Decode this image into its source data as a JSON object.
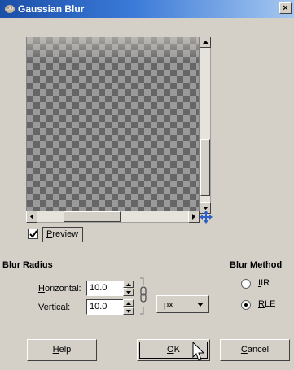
{
  "window": {
    "title": "Gaussian Blur",
    "close_label": "×"
  },
  "preview": {
    "checkbox_label": "Preview",
    "checked": true,
    "accel": "P"
  },
  "blur_radius": {
    "title": "Blur Radius",
    "horizontal": {
      "label": "Horizontal:",
      "accel": "H",
      "value": "10.0"
    },
    "vertical": {
      "label": "Vertical:",
      "accel": "V",
      "value": "10.0"
    },
    "unit": "px"
  },
  "blur_method": {
    "title": "Blur Method",
    "options": [
      {
        "label": "IIR",
        "accel": "I",
        "selected": false
      },
      {
        "label": "RLE",
        "accel": "R",
        "selected": true
      }
    ]
  },
  "buttons": {
    "help": "Help",
    "ok": "OK",
    "cancel": "Cancel"
  },
  "colors": {
    "titlebar_start": "#1b4fa8",
    "titlebar_end": "#a6c8f0",
    "dialog_bg": "#d4d0c8"
  }
}
